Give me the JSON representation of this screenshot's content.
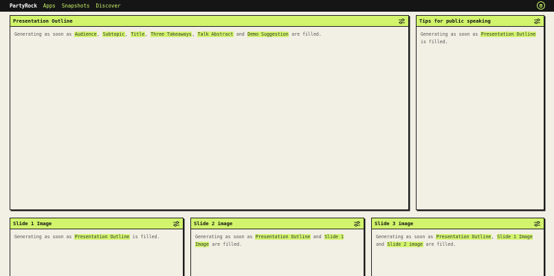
{
  "nav": {
    "brand": "PartyRock",
    "links": [
      "Apps",
      "Snapshots",
      "Discover"
    ]
  },
  "text": {
    "gen": "Generating as soon as",
    "filled_is": "is filled.",
    "filled_are": "are filled.",
    "and": "and",
    "comma": ","
  },
  "panels": {
    "outline": {
      "title": "Presentation Outline",
      "inputs": [
        "Audience",
        "Subtopic",
        "Title",
        "Three Takeaways",
        "Talk Abstract",
        "Demo Suggestion"
      ]
    },
    "tips": {
      "title": "Tips for public speaking",
      "inputs": [
        "Presentation Outline"
      ]
    },
    "slide1": {
      "title": "Slide 1 Image",
      "inputs": [
        "Presentation Outline"
      ]
    },
    "slide2": {
      "title": "Slide 2 image",
      "inputs": [
        "Presentation Outline",
        "Slide 1 Image"
      ]
    },
    "slide3": {
      "title": "Slide 3 image",
      "inputs": [
        "Presentation Outline",
        "Slide 1 Image",
        "Slide 2 image"
      ]
    }
  },
  "colors": {
    "accent": "#d1f46c",
    "nav_link": "#c8f268",
    "background": "#f2efe4",
    "topbar": "#151515"
  }
}
